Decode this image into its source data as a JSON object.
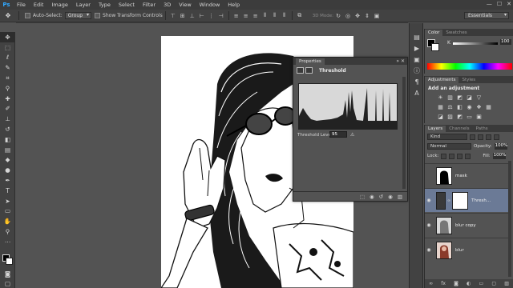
{
  "app": {
    "logo": "Ps"
  },
  "menu": [
    "File",
    "Edit",
    "Image",
    "Layer",
    "Type",
    "Select",
    "Filter",
    "3D",
    "View",
    "Window",
    "Help"
  ],
  "window_controls": [
    "—",
    "☐",
    "✕"
  ],
  "options": {
    "auto_select_label": "Auto-Select:",
    "auto_select_value": "Group",
    "show_transform_label": "Show Transform Controls",
    "mode_3d_label": "3D Mode:",
    "workspace": "Essentials"
  },
  "properties": {
    "tab": "Properties",
    "adjustment_name": "Threshold",
    "threshold_label": "Threshold Level:",
    "threshold_value": "95",
    "warning_icon": "warning-icon"
  },
  "color_panel": {
    "tabs": [
      "Color",
      "Swatches"
    ],
    "k_label": "K",
    "k_value": "100"
  },
  "adjustments_panel": {
    "tabs": [
      "Adjustments",
      "Styles"
    ],
    "title": "Add an adjustment"
  },
  "layers_panel": {
    "tabs": [
      "Layers",
      "Channels",
      "Paths"
    ],
    "kind": "Kind",
    "blend_mode": "Normal",
    "opacity_label": "Opacity:",
    "opacity_value": "100%",
    "lock_label": "Lock:",
    "fill_label": "Fill:",
    "fill_value": "100%",
    "layers": [
      {
        "name": "mask",
        "selected": false,
        "visible": false
      },
      {
        "name": "Thresh...",
        "selected": true,
        "visible": true
      },
      {
        "name": "blur copy",
        "selected": false,
        "visible": true
      },
      {
        "name": "blur",
        "selected": false,
        "visible": true
      }
    ]
  }
}
